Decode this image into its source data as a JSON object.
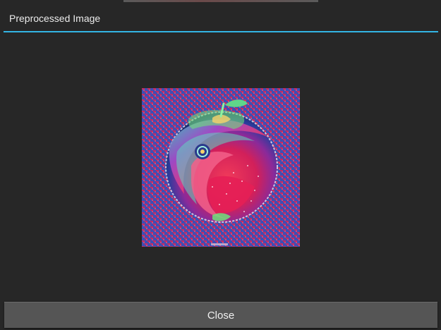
{
  "dialog": {
    "title": "Preprocessed Image",
    "accent_color": "#33b5e5",
    "background_color": "#272727"
  },
  "preview": {
    "image_name": "preprocessed-apple-image",
    "background_colors": [
      "#3f4fb8",
      "#c8295f"
    ]
  },
  "actions": {
    "close_label": "Close"
  }
}
